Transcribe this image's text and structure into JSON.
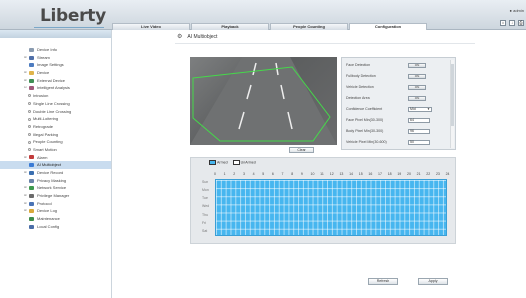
{
  "app": {
    "logo": "Liberty",
    "user": "admin"
  },
  "tabs": [
    {
      "label": "Live Video"
    },
    {
      "label": "Playback"
    },
    {
      "label": "People Counting"
    },
    {
      "label": "Configuration"
    }
  ],
  "header_icons": [
    "home-icon",
    "download-icon",
    "print-icon"
  ],
  "sidebar": {
    "items": [
      {
        "label": "Device Info",
        "level": 1,
        "expand": "",
        "icon": "doc",
        "color": "#8a9bb0"
      },
      {
        "label": "Stream",
        "level": 1,
        "expand": "+",
        "icon": "film",
        "color": "#4f6fa8"
      },
      {
        "label": "Image Settings",
        "level": 1,
        "expand": "",
        "icon": "image",
        "color": "#4d7cc0"
      },
      {
        "label": "Device",
        "level": 1,
        "expand": "+",
        "icon": "folder",
        "color": "#e0b44a"
      },
      {
        "label": "External Device",
        "level": 1,
        "expand": "+",
        "icon": "plug",
        "color": "#3f8f55"
      },
      {
        "label": "Intelligent Analysis",
        "level": 1,
        "expand": "-",
        "icon": "brain",
        "color": "#a0587a"
      },
      {
        "label": "Intrusion",
        "level": 2,
        "expand": "",
        "icon": "",
        "color": ""
      },
      {
        "label": "Single Line Crossing",
        "level": 2,
        "expand": "",
        "icon": "",
        "color": ""
      },
      {
        "label": "Double Line Crossing",
        "level": 2,
        "expand": "",
        "icon": "",
        "color": ""
      },
      {
        "label": "Multi-Loitering",
        "level": 2,
        "expand": "",
        "icon": "",
        "color": ""
      },
      {
        "label": "Retrograde",
        "level": 2,
        "expand": "",
        "icon": "",
        "color": ""
      },
      {
        "label": "Illegal Parking",
        "level": 2,
        "expand": "",
        "icon": "",
        "color": ""
      },
      {
        "label": "People Counting",
        "level": 2,
        "expand": "",
        "icon": "",
        "color": ""
      },
      {
        "label": "Smart Motion",
        "level": 2,
        "expand": "",
        "icon": "",
        "color": ""
      },
      {
        "label": "Alarm",
        "level": 1,
        "expand": "+",
        "icon": "alarm",
        "color": "#c23b3b"
      },
      {
        "label": "AI Multiobject",
        "level": 1,
        "expand": "",
        "icon": "ai",
        "color": "#3a7bd5",
        "selected": true
      },
      {
        "label": "Device Record",
        "level": 1,
        "expand": "+",
        "icon": "record",
        "color": "#3a6fb0"
      },
      {
        "label": "Privacy Masking",
        "level": 1,
        "expand": "",
        "icon": "mask",
        "color": "#6a84a8"
      },
      {
        "label": "Network Service",
        "level": 1,
        "expand": "+",
        "icon": "network",
        "color": "#3e9a4e"
      },
      {
        "label": "Privilege Manager",
        "level": 1,
        "expand": "+",
        "icon": "users",
        "color": "#6b6b6b"
      },
      {
        "label": "Protocol",
        "level": 1,
        "expand": "+",
        "icon": "protocol",
        "color": "#4a73b5"
      },
      {
        "label": "Device Log",
        "level": 1,
        "expand": "+",
        "icon": "log",
        "color": "#d8a93b"
      },
      {
        "label": "Maintenance",
        "level": 1,
        "expand": "",
        "icon": "tool",
        "color": "#3c8d4b"
      },
      {
        "label": "Local Config",
        "level": 1,
        "expand": "",
        "icon": "config",
        "color": "#4b6ea8"
      }
    ]
  },
  "page": {
    "title": "AI Multiobject"
  },
  "video": {
    "clear_label": "Clear"
  },
  "settings": {
    "face_detection": {
      "label": "Face Detection",
      "value": "ON"
    },
    "fullbody_detection": {
      "label": "Fullbody Detection",
      "value": "ON"
    },
    "vehicle_detection": {
      "label": "Vehicle Detection",
      "value": "ON"
    },
    "detection_area": {
      "label": "Detection Area",
      "value": "ON"
    },
    "confidence": {
      "label": "Confidence Coefficient",
      "value": "Mid"
    },
    "face_pixel_min": {
      "label": "Face Pixel Min(30-300)",
      "value": "64"
    },
    "body_pixel_min": {
      "label": "Body Pixel Min(30-300)",
      "value": "96"
    },
    "vehicle_pixel_min": {
      "label": "Vehicle Pixel Min(30-600)",
      "value": "50"
    }
  },
  "schedule": {
    "armed_label": "Armed",
    "unarmed_label": "UnArmed",
    "hours": [
      "0",
      "1",
      "2",
      "3",
      "4",
      "5",
      "6",
      "7",
      "8",
      "9",
      "10",
      "11",
      "12",
      "13",
      "14",
      "15",
      "16",
      "17",
      "18",
      "19",
      "20",
      "21",
      "22",
      "23",
      "24"
    ],
    "days": [
      "Sun",
      "Mon",
      "Tue",
      "Wed",
      "Thu",
      "Fri",
      "Sat"
    ],
    "armed_color": "#47b6ef"
  },
  "actions": {
    "refresh_label": "Refresh",
    "apply_label": "Apply"
  }
}
